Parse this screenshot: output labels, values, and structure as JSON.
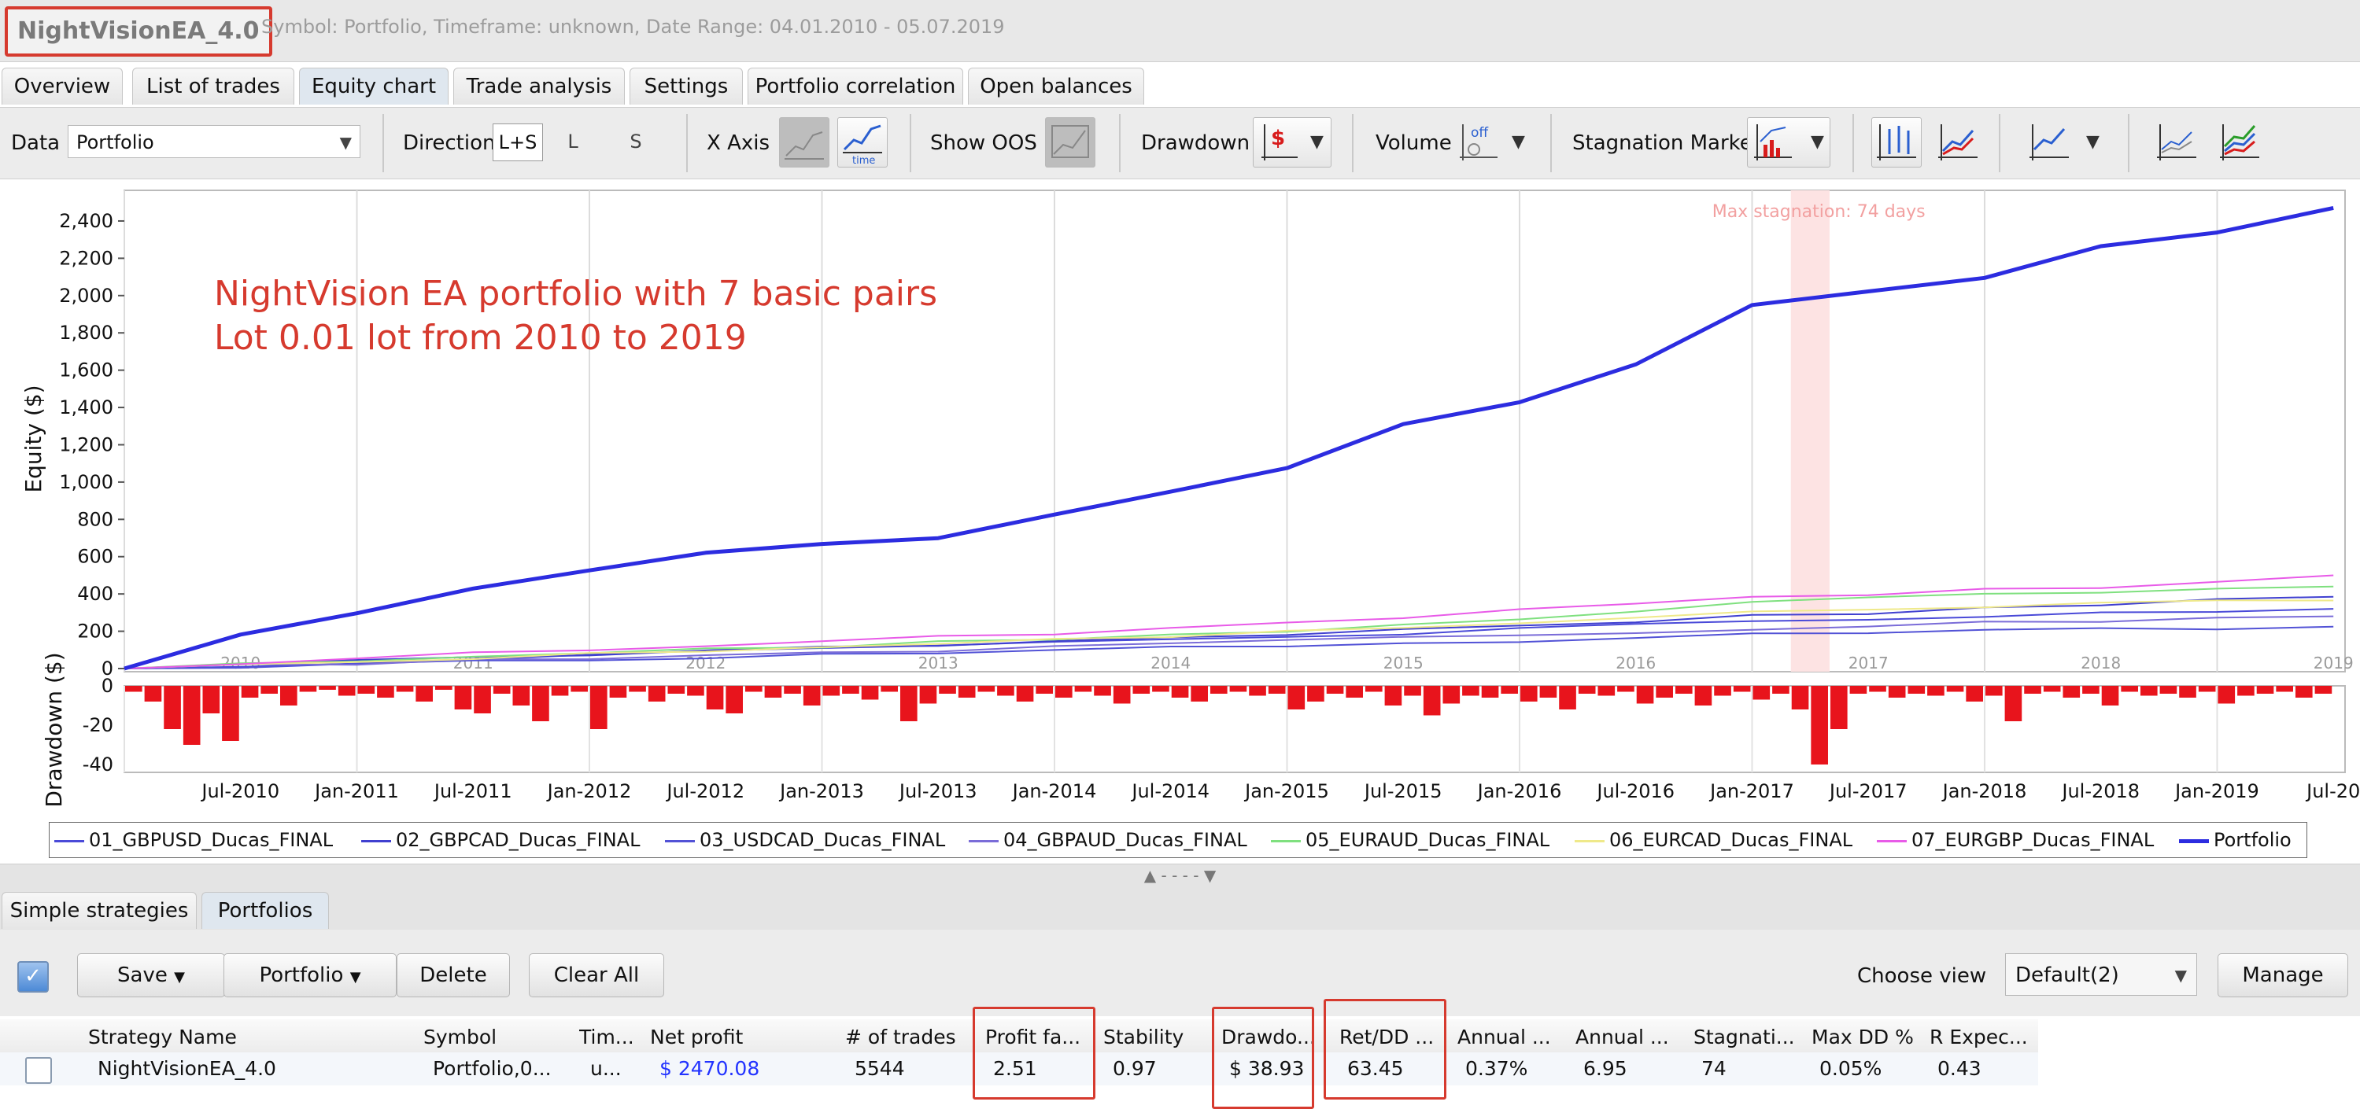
{
  "window": {
    "app_title": "NightVisionEA_4.0",
    "subtitle": "Symbol: Portfolio, Timeframe: unknown, Date Range: 04.01.2010 - 05.07.2019"
  },
  "tabs": [
    "Overview",
    "List of trades",
    "Equity chart",
    "Trade analysis",
    "Settings",
    "Portfolio correlation",
    "Open balances"
  ],
  "active_tab": "Equity chart",
  "toolbar": {
    "data_label": "Data",
    "data_value": "Portfolio",
    "direction_label": "Direction",
    "direction_options": [
      "L+S",
      "L",
      "S"
    ],
    "xaxis_label": "X Axis",
    "show_oos_label": "Show OOS",
    "drawdown_label": "Drawdown",
    "volume_label": "Volume",
    "stagnation_label": "Stagnation Marker",
    "icons": [
      "x-axis-trades-icon",
      "x-axis-time-icon",
      "oos-icon",
      "drawdown-dollar-icon",
      "volume-off-icon",
      "stagnation-marker-icon",
      "chart-style-a-icon",
      "chart-style-b-icon",
      "chart-style-c-icon",
      "chart-style-d-icon",
      "chart-style-e-icon"
    ]
  },
  "chart_data": [
    {
      "type": "line",
      "ylabel": "Equity ($)",
      "ylim": [
        0,
        2480
      ],
      "yticks": [
        "2,400",
        "2,200",
        "2,000",
        "1,800",
        "1,600",
        "1,400",
        "1,200",
        "1,000",
        "800",
        "600",
        "400",
        "200",
        "0"
      ],
      "year_labels": [
        "2010",
        "2011",
        "2012",
        "2013",
        "2014",
        "2015",
        "2016",
        "2017",
        "2018",
        "2019"
      ],
      "annotation": [
        "NightVision EA portfolio with 7 basic pairs",
        "Lot 0.01 lot from 2010 to 2019"
      ],
      "annotation_color": "#d63a2e",
      "stagnation_label": "Max stagnation: 74 days",
      "stagnation_period": [
        "2017-03",
        "2017-05"
      ],
      "x": [
        "2010-01",
        "2010-07",
        "2011-01",
        "2011-07",
        "2012-01",
        "2012-07",
        "2013-01",
        "2013-07",
        "2014-01",
        "2014-07",
        "2015-01",
        "2015-07",
        "2016-01",
        "2016-07",
        "2017-01",
        "2017-07",
        "2018-01",
        "2018-07",
        "2019-01",
        "2019-07"
      ],
      "series": [
        {
          "name": "01_GBPUSD_Ducas_FINAL",
          "color": "#4a4ad8",
          "width": 2,
          "values": [
            0,
            18,
            35,
            52,
            70,
            88,
            105,
            122,
            138,
            155,
            172,
            190,
            210,
            232,
            250,
            268,
            285,
            300,
            312,
            320
          ]
        },
        {
          "name": "02_GBPCAD_Ducas_FINAL",
          "color": "#4040d0",
          "width": 2,
          "values": [
            0,
            20,
            38,
            55,
            75,
            95,
            110,
            130,
            148,
            165,
            185,
            205,
            230,
            255,
            280,
            300,
            320,
            345,
            365,
            385
          ]
        },
        {
          "name": "03_USDCAD_Ducas_FINAL",
          "color": "#5252d6",
          "width": 2,
          "values": [
            0,
            12,
            24,
            36,
            48,
            60,
            72,
            85,
            98,
            110,
            122,
            135,
            150,
            165,
            180,
            192,
            200,
            210,
            218,
            225
          ]
        },
        {
          "name": "04_GBPAUD_Ducas_FINAL",
          "color": "#7a6cd8",
          "width": 2,
          "values": [
            0,
            15,
            28,
            42,
            56,
            70,
            84,
            98,
            112,
            128,
            145,
            162,
            180,
            198,
            215,
            230,
            245,
            258,
            270,
            280
          ]
        },
        {
          "name": "05_EURAUD_Ducas_FINAL",
          "color": "#7fe07f",
          "width": 2,
          "values": [
            0,
            22,
            42,
            62,
            82,
            100,
            120,
            140,
            160,
            180,
            205,
            230,
            270,
            310,
            350,
            380,
            400,
            415,
            430,
            440
          ]
        },
        {
          "name": "06_EURCAD_Ducas_FINAL",
          "color": "#efe98a",
          "width": 2,
          "values": [
            0,
            20,
            40,
            58,
            78,
            96,
            115,
            135,
            155,
            175,
            195,
            220,
            250,
            280,
            300,
            320,
            335,
            350,
            360,
            365
          ]
        },
        {
          "name": "07_EURGBP_Ducas_FINAL",
          "color": "#e85be8",
          "width": 2,
          "values": [
            0,
            30,
            55,
            80,
            105,
            128,
            150,
            172,
            190,
            210,
            240,
            270,
            310,
            350,
            380,
            400,
            420,
            440,
            470,
            500
          ]
        },
        {
          "name": "Portfolio",
          "color": "#2c2ce0",
          "width": 5,
          "values": [
            0,
            160,
            300,
            420,
            540,
            620,
            680,
            720,
            830,
            950,
            1050,
            1300,
            1450,
            1650,
            1960,
            2020,
            2120,
            2240,
            2340,
            2470
          ]
        }
      ]
    },
    {
      "type": "bar",
      "ylabel": "Drawdown ($)",
      "ylim": [
        -40,
        0
      ],
      "yticks": [
        "0",
        "-20",
        "-40"
      ],
      "color": "#e8141c",
      "xtick_labels": [
        "Jul-2010",
        "Jan-2011",
        "Jul-2011",
        "Jan-2012",
        "Jul-2012",
        "Jan-2013",
        "Jul-2013",
        "Jan-2014",
        "Jul-2014",
        "Jan-2015",
        "Jul-2015",
        "Jan-2016",
        "Jul-2016",
        "Jan-2017",
        "Jul-2017",
        "Jan-2018",
        "Jul-2018",
        "Jan-2019",
        "Jul-20"
      ],
      "x": [
        "2010-01",
        "2010-02",
        "2010-03",
        "2010-04",
        "2010-05",
        "2010-06",
        "2010-07",
        "2010-08",
        "2010-09",
        "2010-10",
        "2010-11",
        "2010-12",
        "2011-01",
        "2011-02",
        "2011-03",
        "2011-04",
        "2011-05",
        "2011-06",
        "2011-07",
        "2011-08",
        "2011-09",
        "2011-10",
        "2011-11",
        "2011-12",
        "2012-01",
        "2012-02",
        "2012-03",
        "2012-04",
        "2012-05",
        "2012-06",
        "2012-07",
        "2012-08",
        "2012-09",
        "2012-10",
        "2012-11",
        "2012-12",
        "2013-01",
        "2013-02",
        "2013-03",
        "2013-04",
        "2013-05",
        "2013-06",
        "2013-07",
        "2013-08",
        "2013-09",
        "2013-10",
        "2013-11",
        "2013-12",
        "2014-01",
        "2014-02",
        "2014-03",
        "2014-04",
        "2014-05",
        "2014-06",
        "2014-07",
        "2014-08",
        "2014-09",
        "2014-10",
        "2014-11",
        "2014-12",
        "2015-01",
        "2015-02",
        "2015-03",
        "2015-04",
        "2015-05",
        "2015-06",
        "2015-07",
        "2015-08",
        "2015-09",
        "2015-10",
        "2015-11",
        "2015-12",
        "2016-01",
        "2016-02",
        "2016-03",
        "2016-04",
        "2016-05",
        "2016-06",
        "2016-07",
        "2016-08",
        "2016-09",
        "2016-10",
        "2016-11",
        "2016-12",
        "2017-01",
        "2017-02",
        "2017-03",
        "2017-04",
        "2017-05",
        "2017-06",
        "2017-07",
        "2017-08",
        "2017-09",
        "2017-10",
        "2017-11",
        "2017-12",
        "2018-01",
        "2018-02",
        "2018-03",
        "2018-04",
        "2018-05",
        "2018-06",
        "2018-07",
        "2018-08",
        "2018-09",
        "2018-10",
        "2018-11",
        "2018-12",
        "2019-01",
        "2019-02",
        "2019-03",
        "2019-04",
        "2019-05",
        "2019-06"
      ],
      "values": [
        -3,
        -8,
        -22,
        -30,
        -14,
        -28,
        -6,
        -4,
        -10,
        -3,
        -2,
        -5,
        -4,
        -6,
        -3,
        -8,
        -2,
        -12,
        -14,
        -4,
        -10,
        -18,
        -5,
        -3,
        -22,
        -6,
        -3,
        -8,
        -4,
        -5,
        -12,
        -14,
        -3,
        -6,
        -4,
        -10,
        -5,
        -4,
        -7,
        -3,
        -18,
        -9,
        -4,
        -6,
        -3,
        -5,
        -8,
        -4,
        -6,
        -3,
        -5,
        -9,
        -4,
        -3,
        -6,
        -8,
        -4,
        -3,
        -5,
        -4,
        -12,
        -8,
        -4,
        -6,
        -3,
        -10,
        -5,
        -15,
        -9,
        -5,
        -6,
        -4,
        -8,
        -6,
        -12,
        -4,
        -5,
        -3,
        -9,
        -6,
        -4,
        -10,
        -5,
        -3,
        -7,
        -4,
        -12,
        -40,
        -22,
        -4,
        -3,
        -6,
        -4,
        -5,
        -3,
        -8,
        -5,
        -18,
        -4,
        -3,
        -6,
        -4,
        -10,
        -3,
        -5,
        -4,
        -6,
        -3,
        -9,
        -5,
        -4,
        -3,
        -6,
        -4
      ]
    }
  ],
  "legend": [
    "01_GBPUSD_Ducas_FINAL",
    "02_GBPCAD_Ducas_FINAL",
    "03_USDCAD_Ducas_FINAL",
    "04_GBPAUD_Ducas_FINAL",
    "05_EURAUD_Ducas_FINAL",
    "06_EURCAD_Ducas_FINAL",
    "07_EURGBP_Ducas_FINAL",
    "Portfolio"
  ],
  "splitter_text": "▲ - - - - ▼",
  "bottom_tabs": [
    "Simple strategies",
    "Portfolios"
  ],
  "bottom_active_tab": "Portfolios",
  "bottom_toolbar": {
    "save": "Save",
    "portfolio": "Portfolio",
    "delete": "Delete",
    "clear_all": "Clear All",
    "choose_view_label": "Choose view",
    "choose_view_value": "Default(2)",
    "manage": "Manage"
  },
  "table": {
    "columns": [
      "Strategy Name",
      "Symbol",
      "Tim...",
      "Net profit",
      "# of trades",
      "Profit fa...",
      "Stability",
      "Drawdo...",
      "Ret/DD ...",
      "Annual ...",
      "Annual ...",
      "Stagnati...",
      "Max DD %",
      "R Expec..."
    ],
    "row": [
      "NightVisionEA_4.0",
      "Portfolio,0...",
      "u...",
      "$ 2470.08",
      "5544",
      "2.51",
      "0.97",
      "$ 38.93",
      "63.45",
      "0.37%",
      "6.95",
      "74",
      "0.05%",
      "0.43"
    ],
    "net_profit_color": "#2233ff",
    "highlight_color": "#d63a2e"
  }
}
